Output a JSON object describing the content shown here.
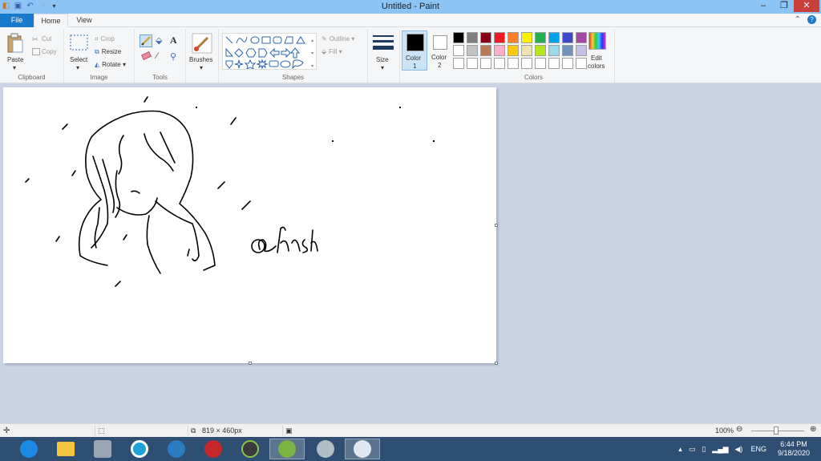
{
  "window": {
    "title": "Untitled - Paint",
    "min": "–",
    "max": "❐",
    "close": "✕"
  },
  "tabs": {
    "file": "File",
    "home": "Home",
    "view": "View"
  },
  "clipboard": {
    "paste": "Paste",
    "cut": "Cut",
    "copy": "Copy",
    "label": "Clipboard"
  },
  "image": {
    "select": "Select",
    "crop": "Crop",
    "resize": "Resize",
    "rotate": "Rotate",
    "label": "Image"
  },
  "tools": {
    "label": "Tools"
  },
  "brushes": {
    "label": "Brushes"
  },
  "shapes": {
    "outline": "Outline",
    "fill": "Fill",
    "label": "Shapes"
  },
  "size": {
    "label": "Size"
  },
  "color1": {
    "label": "Color",
    "num": "1"
  },
  "color2": {
    "label": "Color",
    "num": "2"
  },
  "colors": {
    "label": "Colors",
    "edit_line1": "Edit",
    "edit_line2": "colors",
    "row1": [
      "#000000",
      "#7f7f7f",
      "#880015",
      "#ed1c24",
      "#ff7f27",
      "#fff200",
      "#22b14c",
      "#00a2e8",
      "#3f48cc",
      "#a349a4"
    ],
    "row2": [
      "#ffffff",
      "#c3c3c3",
      "#b97a57",
      "#ffaec9",
      "#ffc90e",
      "#efe4b0",
      "#b5e61d",
      "#99d9ea",
      "#7092be",
      "#c8bfe7"
    ],
    "selected1": "#000000",
    "selected2": "#ffffff"
  },
  "drawing": {
    "signature": "@ hashi"
  },
  "status": {
    "size": "819 × 460px",
    "zoom": "100%"
  },
  "taskbar": {
    "lang": "ENG",
    "time": "6:44 PM",
    "date": "9/18/2020"
  }
}
